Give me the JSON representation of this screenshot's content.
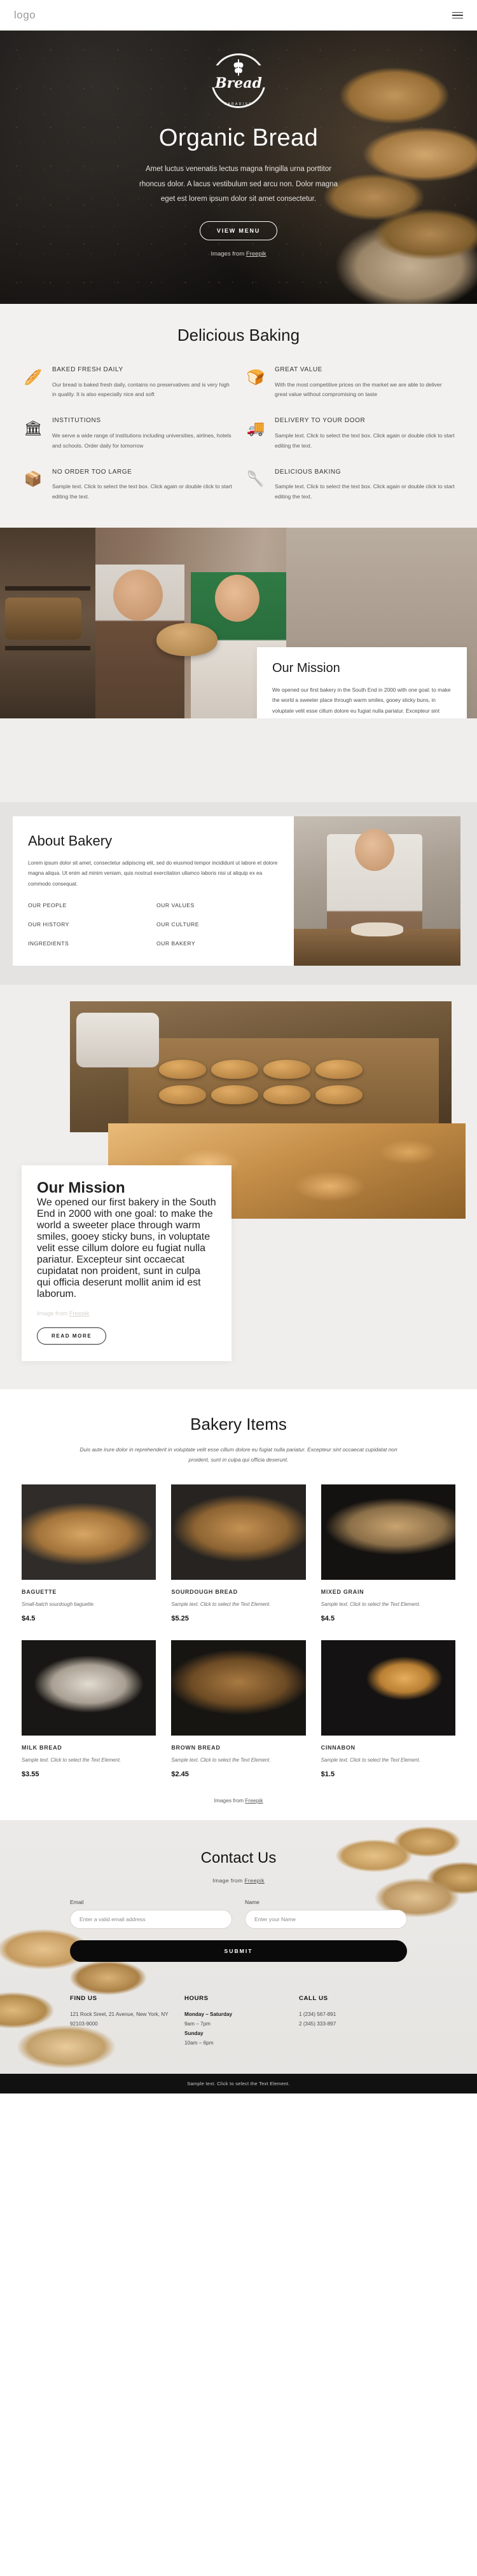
{
  "nav": {
    "logo": "logo",
    "menu_icon": "hamburger-menu-icon"
  },
  "hero": {
    "brand_name": "Bread",
    "brand_sub": "PARADISE",
    "title": "Organic Bread",
    "paragraph": "Amet luctus venenatis lectus magna fringilla urna porttitor rhoncus dolor. A lacus vestibulum sed arcu non. Dolor magna eget est lorem ipsum dolor sit amet consectetur.",
    "cta": "VIEW MENU",
    "credit_prefix": "Images from ",
    "credit_link": "Freepik"
  },
  "features": {
    "heading": "Delicious Baking",
    "items": [
      {
        "icon": "🥖",
        "icon_name": "bread-loaves-icon",
        "title": "BAKED FRESH DAILY",
        "text": "Our bread is baked fresh daily, contains no preservatives and is very high in quality. It is also especially nice and soft"
      },
      {
        "icon": "🍞",
        "icon_name": "hot-bread-icon",
        "title": "GREAT VALUE",
        "text": "With the most competitive prices on the market we are able to deliver great value without compromising on taste"
      },
      {
        "icon": "🏛",
        "icon_name": "institution-building-icon",
        "title": "INSTITUTIONS",
        "text": "We serve a wide range of institutions including universities, airlines, hotels and schools. Order daily for tomorrow"
      },
      {
        "icon": "🚚",
        "icon_name": "delivery-truck-icon",
        "title": "DELIVERY TO YOUR DOOR",
        "text": "Sample text. Click to select the text box. Click again or double click to start editing the text."
      },
      {
        "icon": "📦",
        "icon_name": "package-box-icon",
        "title": "NO ORDER TOO LARGE",
        "text": "Sample text. Click to select the text box. Click again or double click to start editing the text."
      },
      {
        "icon": "🥄",
        "icon_name": "whisk-rolling-pin-icon",
        "title": "DELICIOUS BAKING",
        "text": "Sample text. Click to select the text box. Click again or double click to start editing the text."
      }
    ]
  },
  "mission": {
    "heading": "Our Mission",
    "paragraph": "We opened our first bakery in the South End in 2000 with one goal: to make the world a sweeter place through warm smiles, gooey sticky buns, in voluptate velit esse cillum dolore eu fugiat nulla pariatur. Excepteur sint occaecat cupidatat non proident, sunt in culpa qui officia deserunt mollit anim id est laborum.",
    "credit_prefix": "Image from ",
    "credit_link": "Freepik",
    "cta": "READ MORE"
  },
  "about": {
    "heading": "About Bakery",
    "paragraph": "Lorem ipsum dolor sit amet, consectetur adipiscing elit, sed do eiusmod tempor incididunt ut labore et dolore magna aliqua. Ut enim ad minim veniam, quis nostrud exercitation ullamco laboris nisi ut aliquip ex ea commodo consequat.",
    "links": [
      "OUR PEOPLE",
      "OUR VALUES",
      "OUR HISTORY",
      "OUR CULTURE",
      "INGREDIENTS",
      "OUR BAKERY"
    ]
  },
  "items": {
    "heading": "Bakery Items",
    "subtitle": "Duis aute irure dolor in reprehenderit in voluptate velit esse cillum dolore eu fugiat nulla pariatur. Excepteur sint occaecat cupidatat non proident, sunt in culpa qui officia deserunt.",
    "credit_prefix": "Images from ",
    "credit_link": "Freepik",
    "products": [
      {
        "name": "BAGUETTE",
        "desc": "Small-batch sourdough baguette.",
        "price": "$4.5"
      },
      {
        "name": "SOURDOUGH BREAD",
        "desc": "Sample text. Click to select the Text Element.",
        "price": "$5.25"
      },
      {
        "name": "MIXED GRAIN",
        "desc": "Sample text. Click to select the Text Element.",
        "price": "$4.5"
      },
      {
        "name": "MILK BREAD",
        "desc": "Sample text. Click to select the Text Element.",
        "price": "$3.55"
      },
      {
        "name": "BROWN BREAD",
        "desc": "Sample text. Click to select the Text Element.",
        "price": "$2.45"
      },
      {
        "name": "CINNABON",
        "desc": "Sample text. Click to select the Text Element.",
        "price": "$1.5"
      }
    ]
  },
  "contact": {
    "heading": "Contact Us",
    "credit_prefix": "Image from ",
    "credit_link": "Freepik",
    "email_label": "Email",
    "email_placeholder": "Enter a valid email address",
    "email_value": "",
    "name_label": "Name",
    "name_placeholder": "Enter your Name",
    "name_value": "",
    "submit": "SUBMIT"
  },
  "footer": {
    "find_us_title": "FIND US",
    "find_us_lines": "121 Rock Sreet, 21 Avenue, New York, NY 92103-9000",
    "hours_title": "HOURS",
    "hours_1_label": "Monday – Saturday",
    "hours_1_value": "9am – 7pm",
    "hours_2_label": "Sunday",
    "hours_2_value": "10am – 6pm",
    "call_us_title": "CALL US",
    "phone_1": "1 (234) 567-891",
    "phone_2": "2 (345) 333-897",
    "bottom_bar": "Sample text. Click to select the Text Element."
  },
  "colors": {
    "dark": "#111111",
    "panel": "#f2f1ef",
    "accent_gold": "#c89a5e"
  }
}
